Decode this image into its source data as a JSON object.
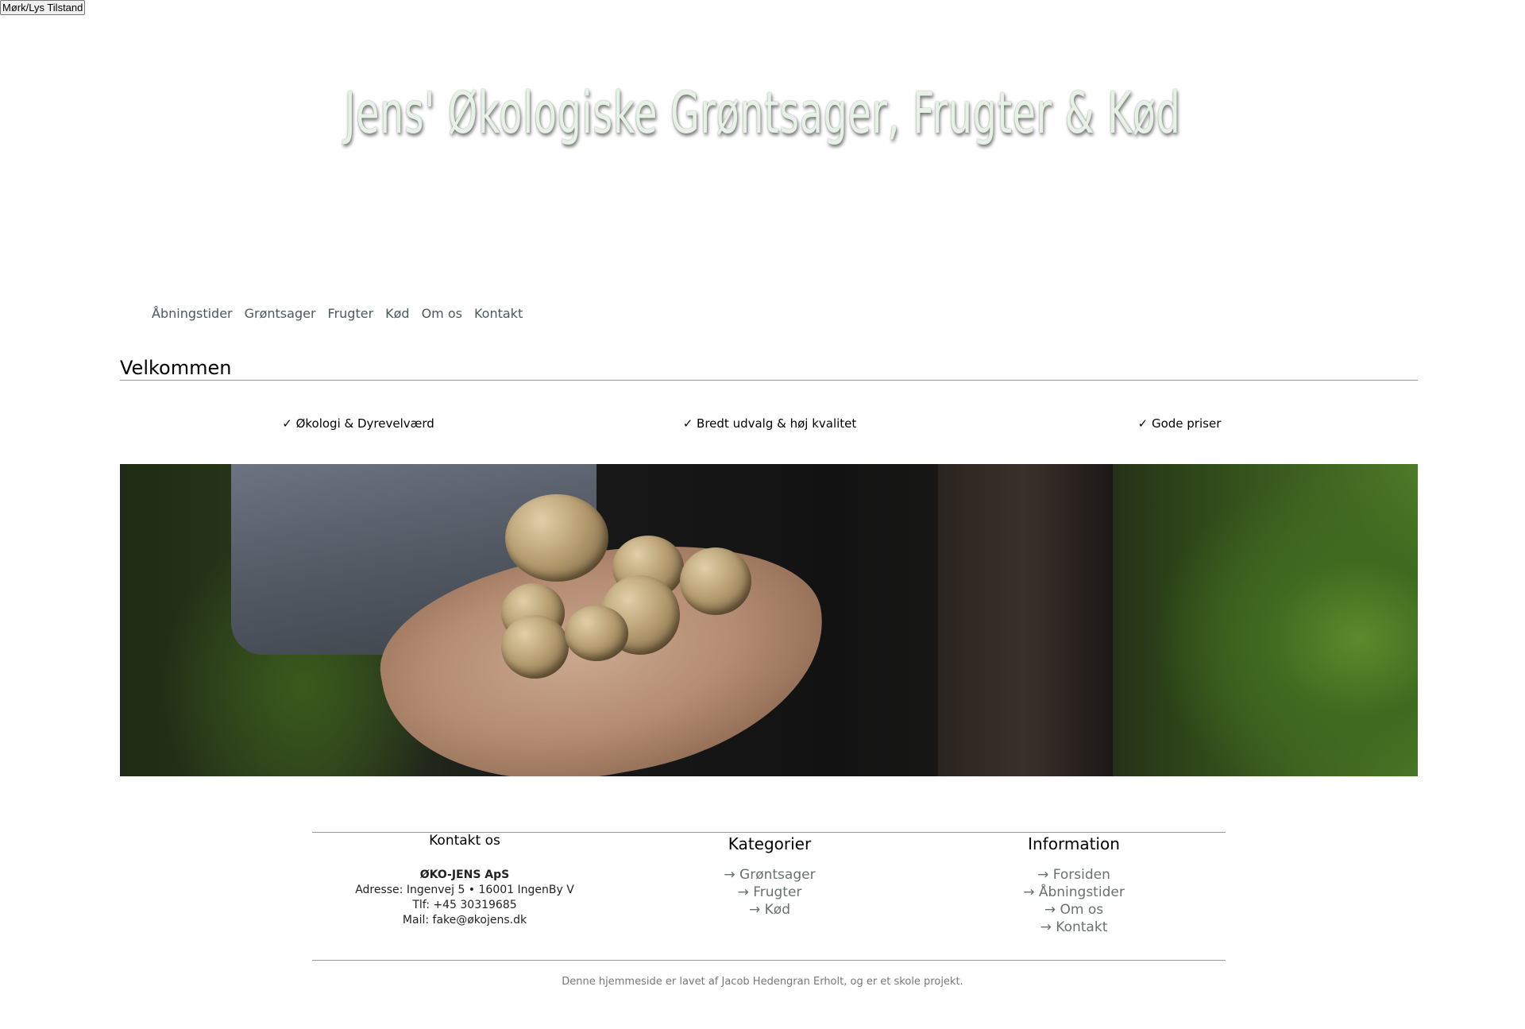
{
  "theme_toggle": {
    "label": "Mørk/Lys Tilstand"
  },
  "header": {
    "title": "Jens' Økologiske Grøntsager, Frugter & Kød"
  },
  "nav": {
    "items": [
      "Åbningstider",
      "Grøntsager",
      "Frugter",
      "Kød",
      "Om os",
      "Kontakt"
    ]
  },
  "main": {
    "heading": "Velkommen",
    "features": [
      "✓ Økologi & Dyrevelværd",
      "✓ Bredt udvalg & høj kvalitet",
      "✓ Gode priser"
    ]
  },
  "footer": {
    "contact": {
      "heading": "Kontakt os",
      "company": "ØKO-JENS ApS",
      "address": "Adresse: Ingenvej 5 • 16001 IngenBy V",
      "phone": "Tlf: +45 30319685",
      "mail": "Mail: fake@økojens.dk"
    },
    "categories": {
      "heading": "Kategorier",
      "links": [
        "→ Grøntsager",
        "→ Frugter",
        "→ Kød"
      ]
    },
    "information": {
      "heading": "Information",
      "links": [
        "→ Forsiden",
        "→ Åbningstider",
        "→ Om os",
        "→ Kontakt"
      ]
    },
    "credit": "Denne hjemmeside er lavet af Jacob Hedengran Erholt, og er et skole projekt."
  },
  "colors": {
    "title_fill": "#e6f2e6",
    "nav_link": "#4a5a5a",
    "footer_link": "#6a7070",
    "divider": "#999999"
  },
  "icons": [
    "checkmark-icon",
    "arrow-right-icon"
  ]
}
